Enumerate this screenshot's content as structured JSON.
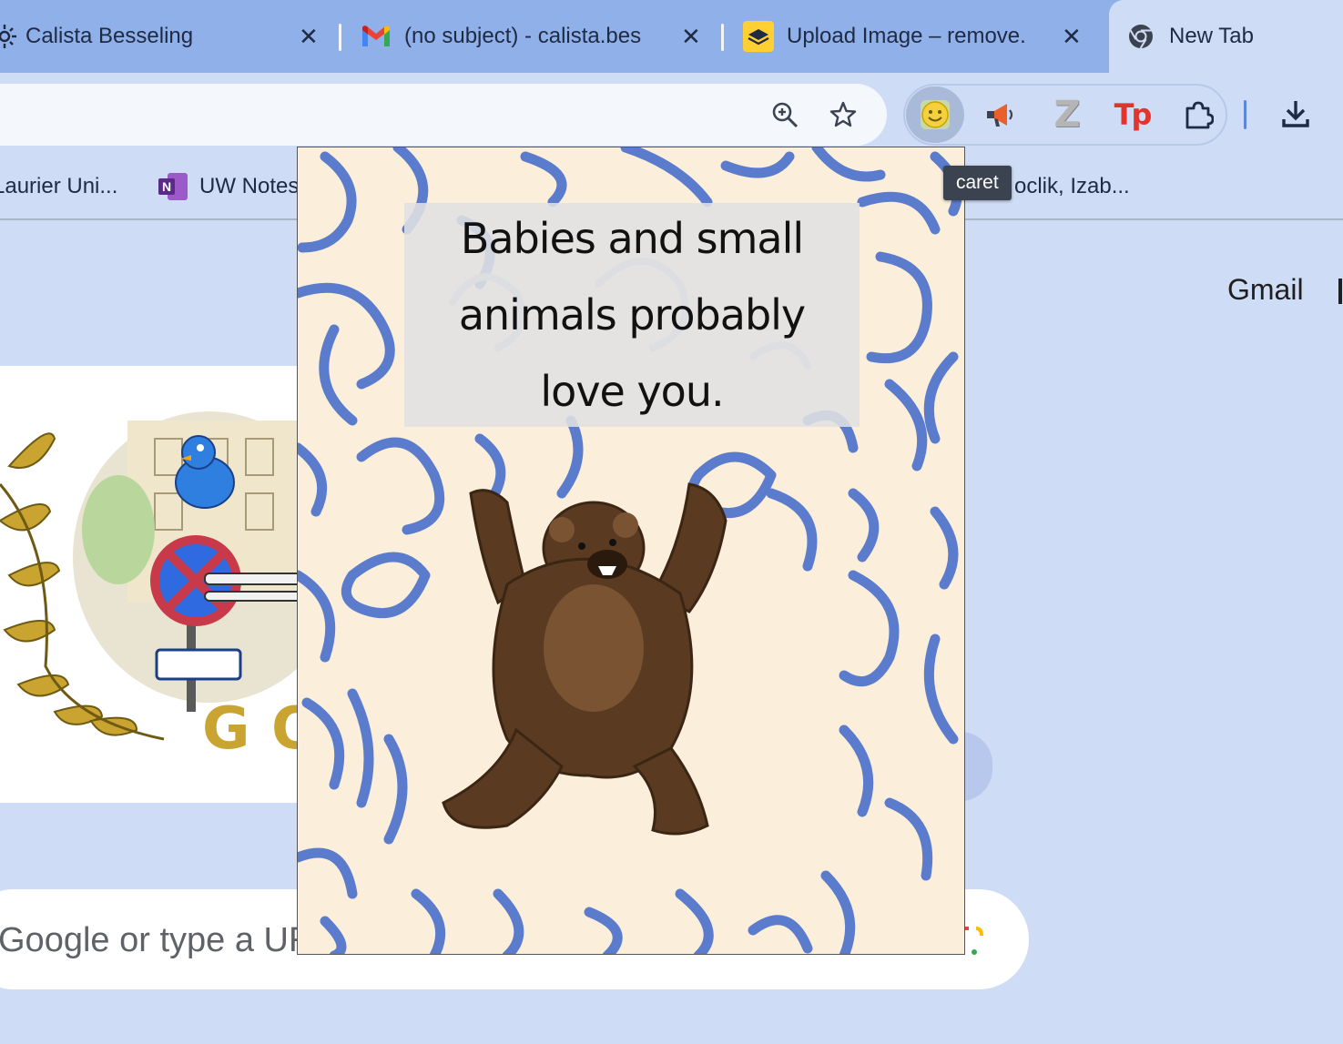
{
  "tabs": [
    {
      "title": "Calista Besseling",
      "icon": "settings-gear-icon"
    },
    {
      "title": "(no subject) - calista.bes",
      "icon": "gmail-icon"
    },
    {
      "title": "Upload Image – remove.",
      "icon": "remove-bg-icon"
    },
    {
      "title": "New Tab",
      "icon": "chrome-icon",
      "active": true
    }
  ],
  "close_glyph": "✕",
  "toolbar": {
    "icons": [
      "zoom-icon",
      "bookmark-star-icon",
      "smiley-extension-icon",
      "megaphone-extension-icon",
      "z-extension-icon",
      "tp-extension-icon",
      "extensions-puzzle-icon",
      "download-icon"
    ],
    "tp_label": "Tp",
    "z_label": "Z"
  },
  "bookmarks": [
    {
      "label": "Laurier Uni...",
      "icon": ""
    },
    {
      "label": "UW Notes",
      "icon": "onenote-icon"
    },
    {
      "label": "oclik, Izab...",
      "icon": ""
    }
  ],
  "onenote_letter": "N",
  "page": {
    "gmail": "Gmail",
    "search_placeholder": "Google or type a URL"
  },
  "popup": {
    "quote": "Babies and small animals probably love you.",
    "image": "grizzly-bear"
  },
  "tooltip": "caret",
  "colors": {
    "tabstrip": "#8fb0e8",
    "page_bg": "#cfdcf5",
    "popup_bg": "#fbeedb",
    "doodle_blue": "#5b7ccc"
  }
}
